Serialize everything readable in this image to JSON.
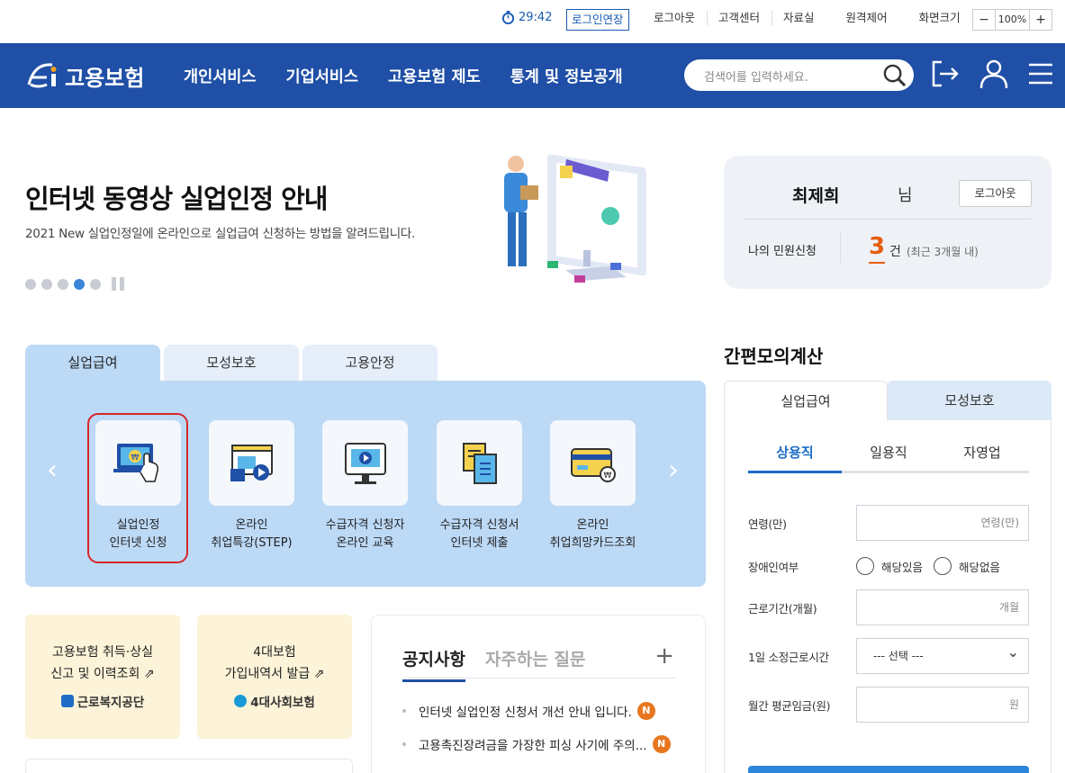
{
  "util": {
    "timer": "29:42",
    "extend_label": "로그인연장",
    "links": [
      "로그아웃",
      "고객센터",
      "자료실",
      "원격제어",
      "화면크기"
    ],
    "zoom_minus": "−",
    "zoom_value": "100%",
    "zoom_plus": "+"
  },
  "header": {
    "logo_text": "고용보험",
    "nav": [
      "개인서비스",
      "기업서비스",
      "고용보험 제도",
      "통계 및 정보공개"
    ],
    "search_placeholder": "검색어를 입력하세요."
  },
  "hero": {
    "title": "인터넷 동영상 실업인정 안내",
    "subtitle": "2021 New 실업인정일에 온라인으로 실업급여 신청하는 방법을 알려드립니다.",
    "slide_count": 5,
    "active_slide": 4
  },
  "user": {
    "name": "최제희",
    "honorific": "님",
    "logout_label": "로그아웃",
    "my_label": "나의 민원신청",
    "count": "3",
    "unit": "건",
    "period": "(최근 3개월 내)"
  },
  "services": {
    "tabs": [
      "실업급여",
      "모성보호",
      "고용안정"
    ],
    "active_tab": 0,
    "items": [
      {
        "line1": "실업인정",
        "line2": "인터넷 신청",
        "icon": "laptop-payment-icon"
      },
      {
        "line1": "온라인",
        "line2": "취업특강(STEP)",
        "icon": "video-lecture-icon"
      },
      {
        "line1": "수급자격 신청자",
        "line2": "온라인 교육",
        "icon": "monitor-play-icon"
      },
      {
        "line1": "수급자격 신청서",
        "line2": "인터넷 제출",
        "icon": "document-icon"
      },
      {
        "line1": "온라인",
        "line2": "취업희망카드조회",
        "icon": "card-icon"
      }
    ],
    "prev": "‹",
    "next": "›"
  },
  "cards": [
    {
      "line1": "고용보험 취득·상실",
      "line2": "신고 및 이력조회",
      "org": "근로복지공단"
    },
    {
      "line1": "4대보험",
      "line2": "가입내역서 발급",
      "org": "4대사회보험"
    }
  ],
  "notice": {
    "tabs": [
      "공지사항",
      "자주하는 질문"
    ],
    "more": "+",
    "items": [
      {
        "text": "인터넷 실업인정 신청서 개선 안내 입니다.",
        "badge": "N"
      },
      {
        "text": "고용촉진장려금을 가장한 피싱 사기에 주의...",
        "badge": "N"
      }
    ]
  },
  "calc": {
    "title": "간편모의계산",
    "tabs": [
      "실업급여",
      "모성보호"
    ],
    "sub_tabs": [
      "상용직",
      "일용직",
      "자영업"
    ],
    "age_label": "연령(만)",
    "age_placeholder": "연령(만)",
    "disability_label": "장애인여부",
    "disability_yes": "해당있음",
    "disability_no": "해당없음",
    "period_label": "근로기간(개월)",
    "period_placeholder": "개월",
    "hours_label": "1일 소정근로시간",
    "hours_value": "--- 선택 ---",
    "wage_label": "월간 평균임금(원)",
    "wage_placeholder": "원"
  }
}
